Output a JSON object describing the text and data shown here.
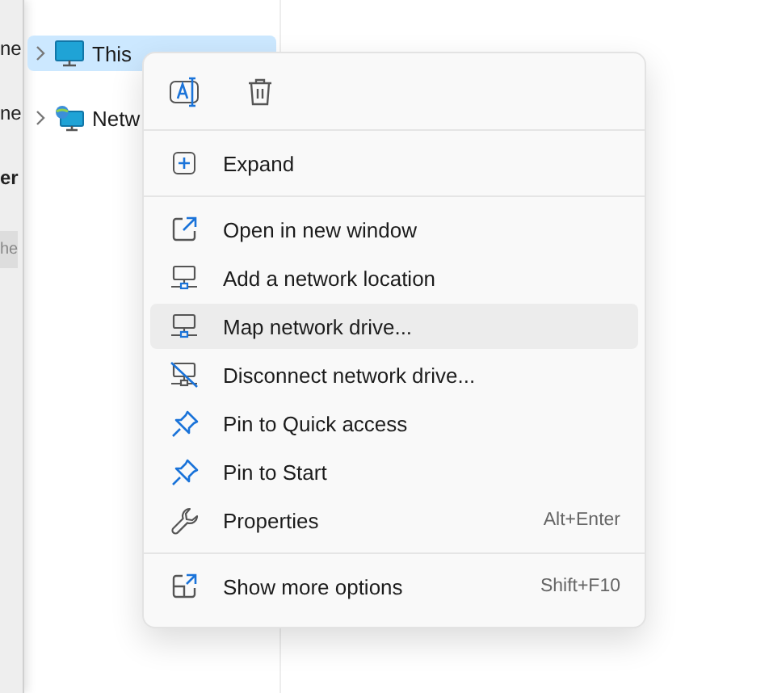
{
  "background_window": {
    "fragments": [
      "ne",
      "ne",
      "er",
      "he"
    ]
  },
  "nav_tree": [
    {
      "label": "This",
      "selected": true,
      "kind": "pc"
    },
    {
      "label": "Netw",
      "selected": false,
      "kind": "network"
    }
  ],
  "context_menu": {
    "quick_actions": [
      {
        "kind": "rename"
      },
      {
        "kind": "delete"
      }
    ],
    "sections": [
      [
        {
          "label": "Expand",
          "kind": "expand",
          "hovered": false
        }
      ],
      [
        {
          "label": "Open in new window",
          "kind": "open-window",
          "hovered": false
        },
        {
          "label": "Add a network location",
          "kind": "network-location",
          "hovered": false
        },
        {
          "label": "Map network drive...",
          "kind": "map-drive",
          "hovered": true
        },
        {
          "label": "Disconnect network drive...",
          "kind": "disconnect-drive",
          "hovered": false
        },
        {
          "label": "Pin to Quick access",
          "kind": "pin",
          "hovered": false
        },
        {
          "label": "Pin to Start",
          "kind": "pin",
          "hovered": false
        },
        {
          "label": "Properties",
          "kind": "properties",
          "shortcut": "Alt+Enter",
          "hovered": false
        }
      ],
      [
        {
          "label": "Show more options",
          "kind": "more-options",
          "shortcut": "Shift+F10",
          "hovered": false
        }
      ]
    ]
  }
}
